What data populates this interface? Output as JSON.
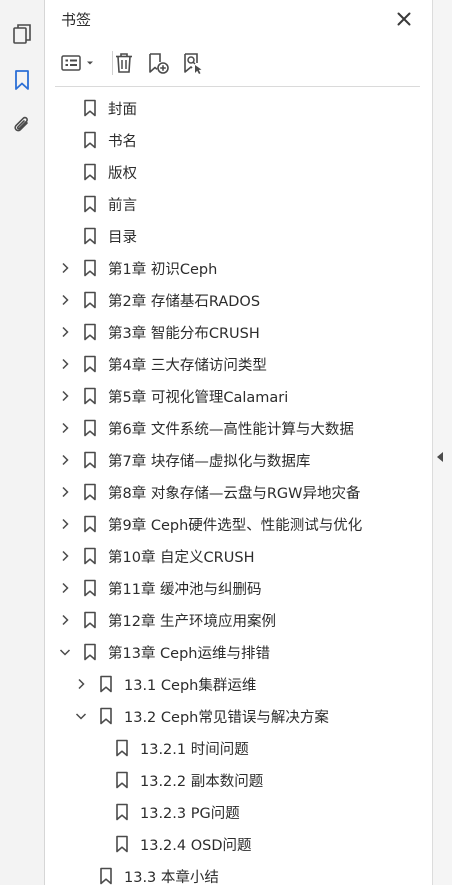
{
  "panel": {
    "title": "书签"
  },
  "rail": {
    "items": [
      {
        "name": "pages-icon",
        "active": false
      },
      {
        "name": "bookmark-icon",
        "active": true
      },
      {
        "name": "attachment-icon",
        "active": false
      }
    ]
  },
  "toolbar": {
    "items": [
      "options-menu-icon",
      "delete-bookmark-icon",
      "new-bookmark-icon",
      "find-current-bookmark-icon"
    ]
  },
  "colors": {
    "accent": "#2b6fd6",
    "icon": "#4b4b4b"
  },
  "bookmarks": [
    {
      "label": "封面",
      "level": 0,
      "state": "leaf"
    },
    {
      "label": "书名",
      "level": 0,
      "state": "leaf"
    },
    {
      "label": "版权",
      "level": 0,
      "state": "leaf"
    },
    {
      "label": "前言",
      "level": 0,
      "state": "leaf"
    },
    {
      "label": "目录",
      "level": 0,
      "state": "leaf"
    },
    {
      "label": "第1章 初识Ceph",
      "level": 0,
      "state": "collapsed"
    },
    {
      "label": "第2章 存储基石RADOS",
      "level": 0,
      "state": "collapsed"
    },
    {
      "label": "第3章 智能分布CRUSH",
      "level": 0,
      "state": "collapsed"
    },
    {
      "label": "第4章 三大存储访问类型",
      "level": 0,
      "state": "collapsed"
    },
    {
      "label": "第5章 可视化管理Calamari",
      "level": 0,
      "state": "collapsed"
    },
    {
      "label": "第6章 文件系统—高性能计算与大数据",
      "level": 0,
      "state": "collapsed"
    },
    {
      "label": "第7章 块存储—虚拟化与数据库",
      "level": 0,
      "state": "collapsed"
    },
    {
      "label": "第8章 对象存储—云盘与RGW异地灾备",
      "level": 0,
      "state": "collapsed"
    },
    {
      "label": "第9章 Ceph硬件选型、性能测试与优化",
      "level": 0,
      "state": "collapsed"
    },
    {
      "label": "第10章 自定义CRUSH",
      "level": 0,
      "state": "collapsed"
    },
    {
      "label": "第11章 缓冲池与纠删码",
      "level": 0,
      "state": "collapsed"
    },
    {
      "label": "第12章 生产环境应用案例",
      "level": 0,
      "state": "collapsed"
    },
    {
      "label": "第13章 Ceph运维与排错",
      "level": 0,
      "state": "expanded"
    },
    {
      "label": "13.1 Ceph集群运维",
      "level": 1,
      "state": "collapsed"
    },
    {
      "label": "13.2 Ceph常见错误与解决方案",
      "level": 1,
      "state": "expanded"
    },
    {
      "label": "13.2.1 时间问题",
      "level": 2,
      "state": "leaf"
    },
    {
      "label": "13.2.2 副本数问题",
      "level": 2,
      "state": "leaf"
    },
    {
      "label": "13.2.3 PG问题",
      "level": 2,
      "state": "leaf"
    },
    {
      "label": "13.2.4 OSD问题",
      "level": 2,
      "state": "leaf"
    },
    {
      "label": "13.3 本章小结",
      "level": 1,
      "state": "leaf"
    }
  ]
}
